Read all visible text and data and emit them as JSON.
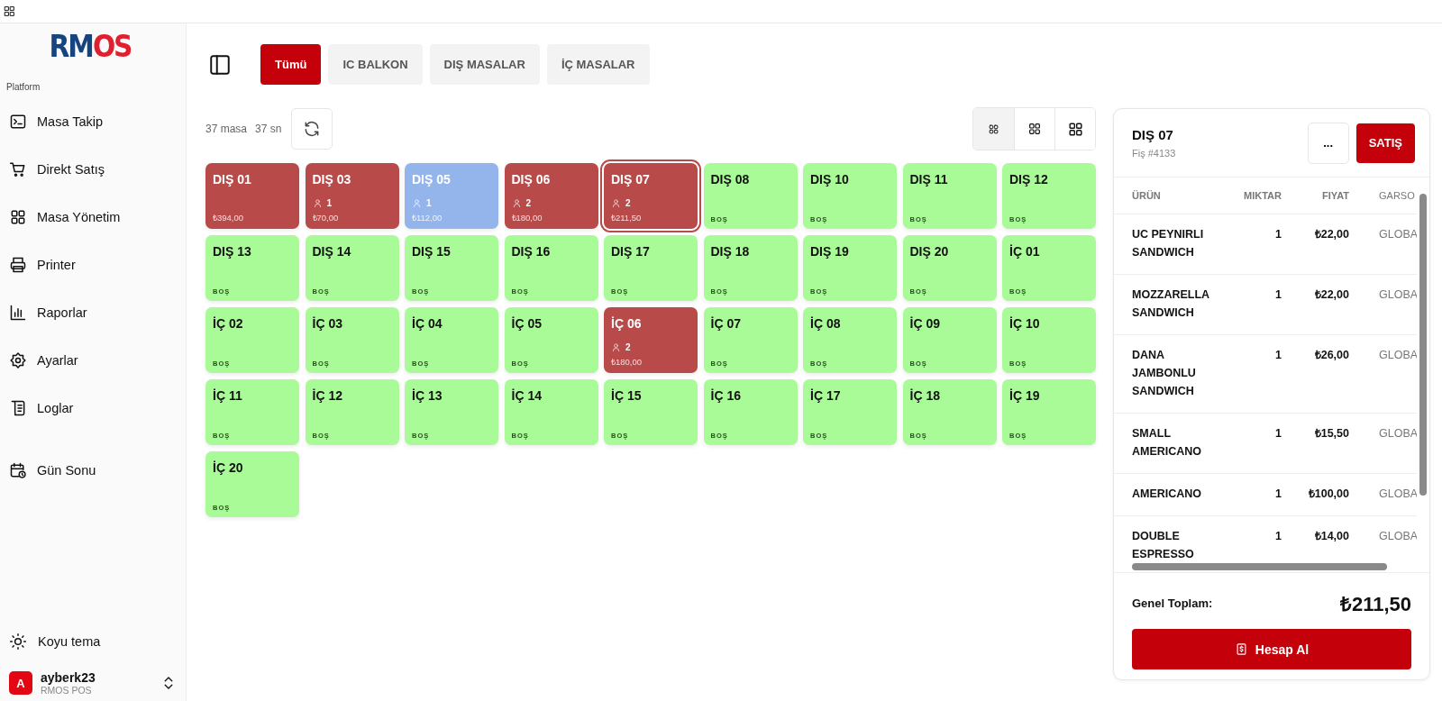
{
  "logo": "RMOS",
  "sidebar": {
    "section_label": "Platform",
    "items": [
      {
        "label": "Masa Takip",
        "selected": false
      },
      {
        "label": "Direkt Satış",
        "selected": false
      },
      {
        "label": "Masa Yönetim",
        "selected": false
      },
      {
        "label": "Printer",
        "selected": false
      },
      {
        "label": "Raporlar",
        "selected": false
      },
      {
        "label": "Ayarlar",
        "selected": false
      },
      {
        "label": "Loglar",
        "selected": false
      },
      {
        "label": "Gün Sonu",
        "selected": false
      }
    ],
    "theme_toggle": "Koyu tema",
    "user": {
      "initial": "A",
      "name": "ayberk23",
      "subtitle": "RMOS POS"
    }
  },
  "filter_tabs": [
    {
      "label": "Tümü",
      "selected": true
    },
    {
      "label": "IC BALKON",
      "selected": false
    },
    {
      "label": "DIŞ MASALAR",
      "selected": false
    },
    {
      "label": "İÇ MASALAR",
      "selected": false
    }
  ],
  "table_count": "37 masa",
  "refresh_timer": "37 sn",
  "view_sizes": [
    {
      "kind": "small",
      "selected": true
    },
    {
      "kind": "medium",
      "selected": false
    },
    {
      "kind": "large",
      "selected": false
    }
  ],
  "tables": [
    {
      "name": "DIŞ 01",
      "kind": "occupied",
      "selected": false,
      "footer": "₺394,00"
    },
    {
      "name": "DIŞ 03",
      "kind": "occupied",
      "selected": false,
      "guests": "1",
      "footer": "₺70,00"
    },
    {
      "name": "DIŞ 05",
      "kind": "reserved",
      "selected": false,
      "guests": "1",
      "footer": "₺112,00"
    },
    {
      "name": "DIŞ 06",
      "kind": "occupied",
      "selected": false,
      "guests": "2",
      "footer": "₺180,00"
    },
    {
      "name": "DIŞ 07",
      "kind": "occupied",
      "selected": true,
      "guests": "2",
      "footer": "₺211,50"
    },
    {
      "name": "DIŞ 08",
      "kind": "empty",
      "selected": false,
      "footer": "BOŞ"
    },
    {
      "name": "DIŞ 10",
      "kind": "empty",
      "selected": false,
      "footer": "BOŞ"
    },
    {
      "name": "DIŞ 11",
      "kind": "empty",
      "selected": false,
      "footer": "BOŞ"
    },
    {
      "name": "DIŞ 12",
      "kind": "empty",
      "selected": false,
      "footer": "BOŞ"
    },
    {
      "name": "DIŞ 13",
      "kind": "empty",
      "selected": false,
      "footer": "BOŞ"
    },
    {
      "name": "DIŞ 14",
      "kind": "empty",
      "selected": false,
      "footer": "BOŞ"
    },
    {
      "name": "DIŞ 15",
      "kind": "empty",
      "selected": false,
      "footer": "BOŞ"
    },
    {
      "name": "DIŞ 16",
      "kind": "empty",
      "selected": false,
      "footer": "BOŞ"
    },
    {
      "name": "DIŞ 17",
      "kind": "empty",
      "selected": false,
      "footer": "BOŞ"
    },
    {
      "name": "DIŞ 18",
      "kind": "empty",
      "selected": false,
      "footer": "BOŞ"
    },
    {
      "name": "DIŞ 19",
      "kind": "empty",
      "selected": false,
      "footer": "BOŞ"
    },
    {
      "name": "DIŞ 20",
      "kind": "empty",
      "selected": false,
      "footer": "BOŞ"
    },
    {
      "name": "İÇ 01",
      "kind": "empty",
      "selected": false,
      "footer": "BOŞ"
    },
    {
      "name": "İÇ 02",
      "kind": "empty",
      "selected": false,
      "footer": "BOŞ"
    },
    {
      "name": "İÇ 03",
      "kind": "empty",
      "selected": false,
      "footer": "BOŞ"
    },
    {
      "name": "İÇ 04",
      "kind": "empty",
      "selected": false,
      "footer": "BOŞ"
    },
    {
      "name": "İÇ 05",
      "kind": "empty",
      "selected": false,
      "footer": "BOŞ"
    },
    {
      "name": "İÇ 06",
      "kind": "occupied",
      "selected": false,
      "guests": "2",
      "footer": "₺180,00"
    },
    {
      "name": "İÇ 07",
      "kind": "empty",
      "selected": false,
      "footer": "BOŞ"
    },
    {
      "name": "İÇ 08",
      "kind": "empty",
      "selected": false,
      "footer": "BOŞ"
    },
    {
      "name": "İÇ 09",
      "kind": "empty",
      "selected": false,
      "footer": "BOŞ"
    },
    {
      "name": "İÇ 10",
      "kind": "empty",
      "selected": false,
      "footer": "BOŞ"
    },
    {
      "name": "İÇ 11",
      "kind": "empty",
      "selected": false,
      "footer": "BOŞ"
    },
    {
      "name": "İÇ 12",
      "kind": "empty",
      "selected": false,
      "footer": "BOŞ"
    },
    {
      "name": "İÇ 13",
      "kind": "empty",
      "selected": false,
      "footer": "BOŞ"
    },
    {
      "name": "İÇ 14",
      "kind": "empty",
      "selected": false,
      "footer": "BOŞ"
    },
    {
      "name": "İÇ 15",
      "kind": "empty",
      "selected": false,
      "footer": "BOŞ"
    },
    {
      "name": "İÇ 16",
      "kind": "empty",
      "selected": false,
      "footer": "BOŞ"
    },
    {
      "name": "İÇ 17",
      "kind": "empty",
      "selected": false,
      "footer": "BOŞ"
    },
    {
      "name": "İÇ 18",
      "kind": "empty",
      "selected": false,
      "footer": "BOŞ"
    },
    {
      "name": "İÇ 19",
      "kind": "empty",
      "selected": false,
      "footer": "BOŞ"
    },
    {
      "name": "İÇ 20",
      "kind": "empty",
      "selected": false,
      "footer": "BOŞ"
    }
  ],
  "order": {
    "title": "DIŞ 07",
    "receipt": "Fiş #4133",
    "more_button": "...",
    "sale_button": "SATIŞ",
    "columns": [
      "ÜRÜN",
      "MIKTAR",
      "FIYAT",
      "GARSO"
    ],
    "rows": [
      {
        "product": "UC PEYNIRLI SANDWICH",
        "quantity": "1",
        "price": "₺22,00",
        "waiter": "GLOBA"
      },
      {
        "product": "MOZZARELLA SANDWICH",
        "quantity": "1",
        "price": "₺22,00",
        "waiter": "GLOBA"
      },
      {
        "product": "DANA JAMBONLU SANDWICH",
        "quantity": "1",
        "price": "₺26,00",
        "waiter": "GLOBA"
      },
      {
        "product": "SMALL AMERICANO",
        "quantity": "1",
        "price": "₺15,50",
        "waiter": "GLOBA"
      },
      {
        "product": "AMERICANO",
        "quantity": "1",
        "price": "₺100,00",
        "waiter": "GLOBA"
      },
      {
        "product": "DOUBLE ESPRESSO",
        "quantity": "1",
        "price": "₺14,00",
        "waiter": "GLOBA"
      }
    ],
    "total_label": "Genel Toplam:",
    "total": "₺211,50",
    "checkout_button": "Hesap Al"
  }
}
